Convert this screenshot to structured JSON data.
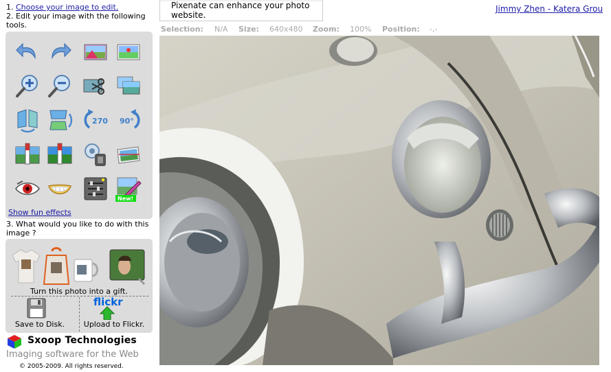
{
  "left": {
    "step1_prefix": "1.",
    "step1_link": "Choose your image to edit.",
    "step2": "2. Edit your image with the following tools.",
    "fun_effects_link": "Show fun effects",
    "step3": "3. What would you like to do with this image ?",
    "gift_label": "Turn this photo into a gift.",
    "save_label": "Save to Disk.",
    "flickr_label": "Upload to Flickr.",
    "flickr_logo": "flickr",
    "new_badge": "New!"
  },
  "tools": [
    {
      "name": "undo-icon"
    },
    {
      "name": "redo-icon"
    },
    {
      "name": "enhance-icon"
    },
    {
      "name": "auto-fix-icon"
    },
    {
      "name": "zoom-in-icon"
    },
    {
      "name": "zoom-out-icon"
    },
    {
      "name": "crop-icon"
    },
    {
      "name": "resize-icon"
    },
    {
      "name": "flip-horizontal-icon"
    },
    {
      "name": "flip-vertical-icon"
    },
    {
      "name": "rotate-270-icon"
    },
    {
      "name": "rotate-90-icon"
    },
    {
      "name": "brightness-icon"
    },
    {
      "name": "contrast-icon"
    },
    {
      "name": "sharpen-icon"
    },
    {
      "name": "straighten-icon"
    },
    {
      "name": "red-eye-icon"
    },
    {
      "name": "teeth-whiten-icon"
    },
    {
      "name": "adjust-sliders-icon"
    },
    {
      "name": "draw-icon"
    }
  ],
  "tool_text": {
    "rot270": "270°",
    "rot90": "90°"
  },
  "brand": {
    "name": "Sxoop Technologies",
    "tagline": "Imaging software for the Web",
    "copyright": "© 2005-2009. All rights reserved."
  },
  "header": {
    "notice": "Pixenate can enhance your photo website.",
    "user_link": "Jimmy Zhen - Katera Grou"
  },
  "status": {
    "selection_label": "Selection:",
    "selection_value": "N/A",
    "size_label": "Size:",
    "size_value": "640x480",
    "zoom_label": "Zoom:",
    "zoom_value": "100%",
    "position_label": "Position:",
    "position_value": "-,-"
  },
  "colors": {
    "link": "#1a1aa6",
    "panel": "#dcdcdc",
    "status_text": "#aaaaaa"
  }
}
